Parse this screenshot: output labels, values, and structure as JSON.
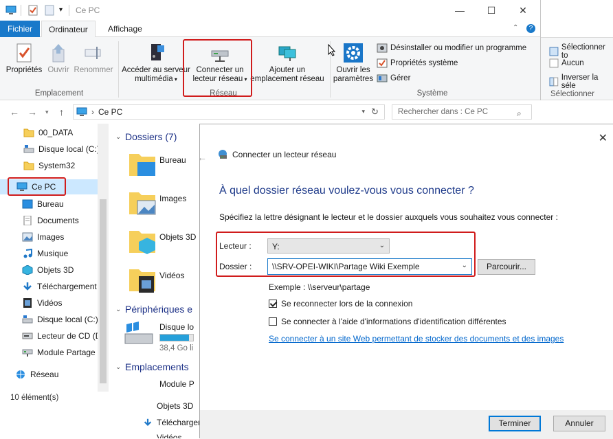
{
  "window": {
    "title": "Ce PC",
    "controls": {
      "minimize": "—",
      "maximize": "☐",
      "close": "✕"
    }
  },
  "ribbon": {
    "tabs": [
      {
        "label": "Fichier"
      },
      {
        "label": "Ordinateur"
      },
      {
        "label": "Affichage"
      }
    ],
    "emplacement": {
      "label": "Emplacement",
      "buttons": [
        "Propriétés",
        "Ouvrir",
        "Renommer"
      ]
    },
    "reseau": {
      "label": "Réseau",
      "media_line1": "Accéder au serveur",
      "media_line2": "multimédia",
      "connect_line1": "Connecter un",
      "connect_line2": "lecteur réseau",
      "add_line1": "Ajouter un",
      "add_line2": "emplacement réseau"
    },
    "systeme": {
      "label": "Système",
      "settings_line1": "Ouvrir les",
      "settings_line2": "paramètres",
      "uninstall": "Désinstaller ou modifier un programme",
      "props": "Propriétés système",
      "manage": "Gérer"
    },
    "right": {
      "select_all": "Sélectionner to",
      "none": "Aucun",
      "invert": "Inverser la séle",
      "label": "Sélectionner"
    }
  },
  "address": {
    "path": "Ce PC",
    "search_placeholder": "Rechercher dans : Ce PC"
  },
  "navpane": {
    "items": [
      {
        "label": "00_DATA",
        "icon": "folder-icon"
      },
      {
        "label": "Disque local (C:)",
        "icon": "drive-icon"
      },
      {
        "label": "System32",
        "icon": "folder-icon"
      },
      {
        "label": "Ce PC",
        "icon": "computer-icon"
      },
      {
        "label": "Bureau",
        "icon": "desktop-icon"
      },
      {
        "label": "Documents",
        "icon": "documents-icon"
      },
      {
        "label": "Images",
        "icon": "images-icon"
      },
      {
        "label": "Musique",
        "icon": "music-icon"
      },
      {
        "label": "Objets 3D",
        "icon": "3d-icon"
      },
      {
        "label": "Téléchargement",
        "icon": "download-icon"
      },
      {
        "label": "Vidéos",
        "icon": "video-icon"
      },
      {
        "label": "Disque local (C:)",
        "icon": "drive-icon"
      },
      {
        "label": "Lecteur de CD (D",
        "icon": "cd-icon"
      },
      {
        "label": "Module Partage",
        "icon": "network-drive-icon"
      },
      {
        "label": "Réseau",
        "icon": "network-icon"
      }
    ],
    "status": "10 élément(s)"
  },
  "content": {
    "folders_header": "Dossiers (7)",
    "folders": [
      "Bureau",
      "Images",
      "Objets 3D",
      "Vidéos"
    ],
    "devices_header": "Périphériques e",
    "device_name": "Disque lo",
    "device_space": "38,4 Go li",
    "locations_header": "Emplacements",
    "location_name": "Module P",
    "bottom_items": [
      "Objets 3D",
      "Téléchargements",
      "Vidéos"
    ]
  },
  "dialog": {
    "title": "Connecter un lecteur réseau",
    "heading": "À quel dossier réseau voulez-vous vous connecter ?",
    "instruction": "Spécifiez la lettre désignant le lecteur et le dossier auxquels vous souhaitez vous connecter :",
    "drive_label": "Lecteur :",
    "drive_value": "Y:",
    "folder_label": "Dossier :",
    "folder_value": "\\\\SRV-OPEI-WIKI\\Partage Wiki Exemple",
    "browse": "Parcourir...",
    "example": "Exemple : \\\\serveur\\partage",
    "reconnect": "Se reconnecter lors de la connexion",
    "reconnect_checked": true,
    "other_creds": "Se connecter à l'aide d'informations d'identification différentes",
    "other_creds_checked": false,
    "web_link": "Se connecter à un site Web permettant de stocker des documents et des images",
    "finish": "Terminer",
    "cancel": "Annuler"
  },
  "colors": {
    "accent": "#1979ca",
    "highlight_red": "#d01c1c",
    "selected_bg": "#cce8ff",
    "heading_blue": "#1e3a8a",
    "link": "#0066cc"
  }
}
